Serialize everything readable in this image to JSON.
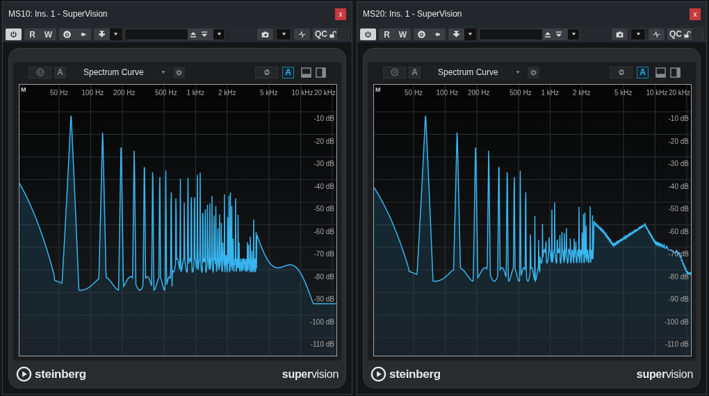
{
  "windows": [
    {
      "title": "MS10: Ins. 1 - SuperVision",
      "close": "x",
      "toolbar": {
        "power_on": true,
        "read": "R",
        "write": "W",
        "qc": "QC"
      },
      "plugin": {
        "hold_toggle": {
          "label": "A",
          "selected": false
        },
        "view": "Spectrum Curve",
        "auto_toggle": {
          "label": "A",
          "selected": true
        },
        "channel": "M",
        "freq_labels": [
          "50 Hz",
          "100 Hz",
          "200 Hz",
          "500 Hz",
          "1 kHz",
          "2 kHz",
          "5 kHz",
          "10 kHz",
          "20 kHz"
        ],
        "db_labels": [
          "-10 dB",
          "-20 dB",
          "-30 dB",
          "-40 dB",
          "-50 dB",
          "-60 dB",
          "-70 dB",
          "-80 dB",
          "-90 dB",
          "-100 dB",
          "-110 dB"
        ],
        "brand": "steinberg",
        "product": "**super**vision"
      }
    },
    {
      "title": "MS20: Ins. 1 - SuperVision",
      "close": "x",
      "toolbar": {
        "power_on": true,
        "read": "R",
        "write": "W",
        "qc": "QC"
      },
      "plugin": {
        "hold_toggle": {
          "label": "A",
          "selected": false
        },
        "view": "Spectrum Curve",
        "auto_toggle": {
          "label": "A",
          "selected": true
        },
        "channel": "M",
        "freq_labels": [
          "50 Hz",
          "100 Hz",
          "200 Hz",
          "500 Hz",
          "1 kHz",
          "2 kHz",
          "5 kHz",
          "10 kHz",
          "20 kHz"
        ],
        "db_labels": [
          "-10 dB",
          "-20 dB",
          "-30 dB",
          "-40 dB",
          "-50 dB",
          "-60 dB",
          "-70 dB",
          "-80 dB",
          "-90 dB",
          "-100 dB",
          "-110 dB"
        ],
        "brand": "steinberg",
        "product": "**super**vision"
      }
    }
  ]
}
